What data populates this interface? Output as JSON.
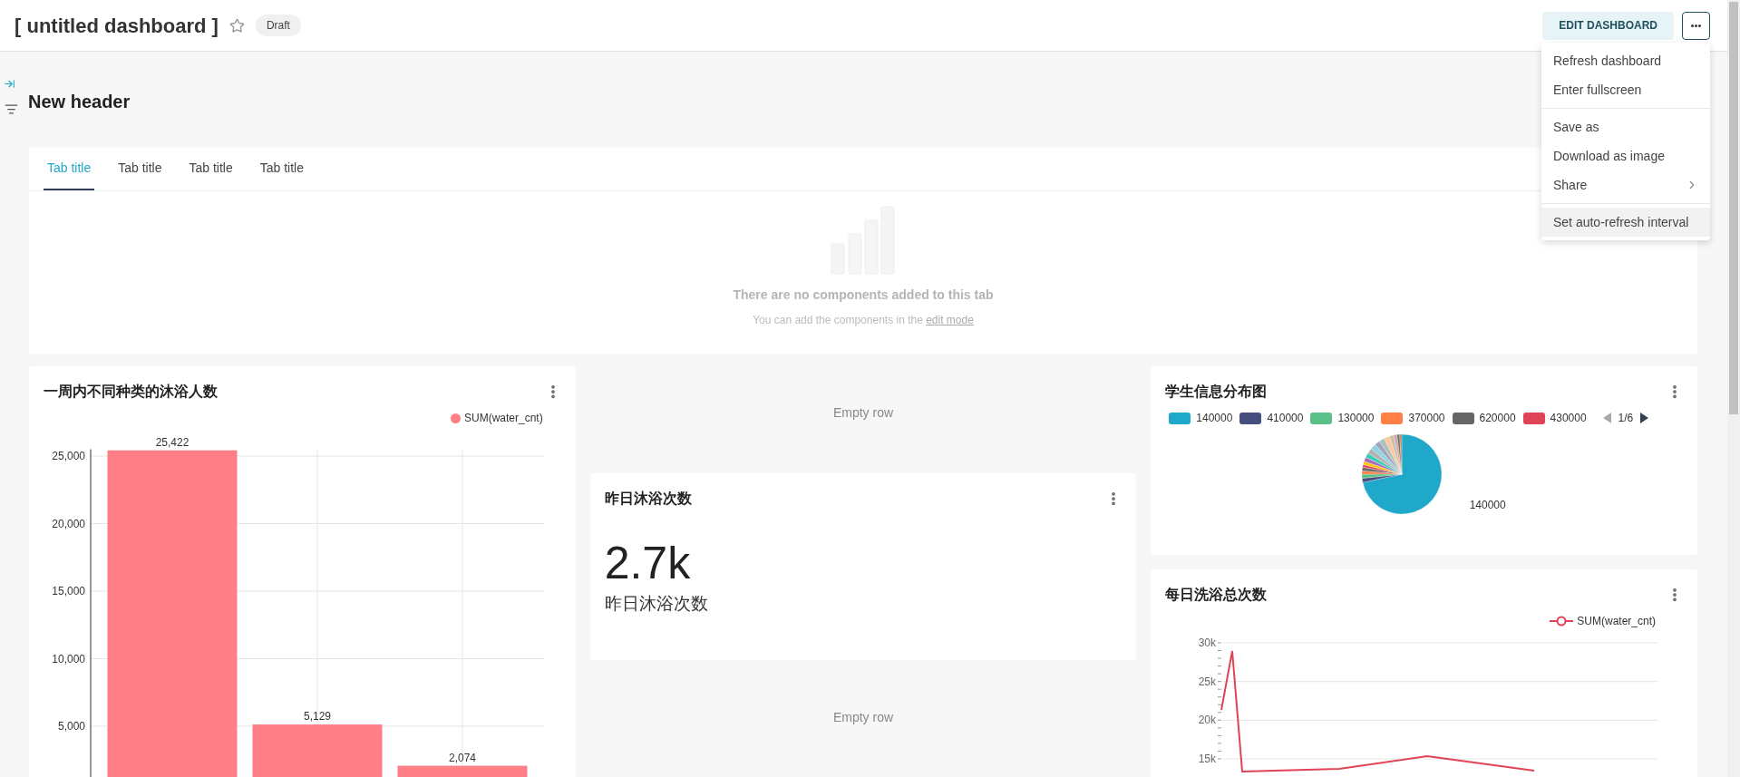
{
  "header": {
    "title": "[ untitled dashboard ]",
    "starred": false,
    "badge": "Draft",
    "edit_button": "EDIT DASHBOARD"
  },
  "menu": {
    "groups": [
      [
        {
          "label": "Refresh dashboard",
          "has_submenu": false,
          "highlighted": false
        },
        {
          "label": "Enter fullscreen",
          "has_submenu": false,
          "highlighted": false
        }
      ],
      [
        {
          "label": "Save as",
          "has_submenu": false,
          "highlighted": false
        },
        {
          "label": "Download as image",
          "has_submenu": false,
          "highlighted": false
        },
        {
          "label": "Share",
          "has_submenu": true,
          "highlighted": false
        }
      ],
      [
        {
          "label": "Set auto-refresh interval",
          "has_submenu": false,
          "highlighted": true
        }
      ]
    ]
  },
  "section_header": "New header",
  "tabs": [
    {
      "label": "Tab title",
      "selected": true
    },
    {
      "label": "Tab title",
      "selected": false
    },
    {
      "label": "Tab title",
      "selected": false
    },
    {
      "label": "Tab title",
      "selected": false
    }
  ],
  "empty_tab": {
    "title": "There are no components added to this tab",
    "text": "You can add the components in the",
    "link": "edit mode"
  },
  "bar_card": {
    "title": "一周内不同种类的沐浴人数",
    "chart_data": {
      "type": "bar",
      "series": [
        {
          "name": "SUM(water_cnt)",
          "color": "#ff7f86",
          "values": [
            25422,
            5129,
            2074
          ]
        }
      ],
      "ylim": [
        0,
        25500
      ],
      "yticks": [
        {
          "value": 5000,
          "label": "5,000"
        },
        {
          "value": 10000,
          "label": "10,000"
        },
        {
          "value": 15000,
          "label": "15,000"
        },
        {
          "value": 20000,
          "label": "20,000"
        },
        {
          "value": 25000,
          "label": "25,000"
        }
      ],
      "grid": true,
      "value_labels": [
        "25,422",
        "5,129",
        "2,074"
      ]
    }
  },
  "empty_rows": [
    "Empty row",
    "Empty row"
  ],
  "big_number_card": {
    "title": "昨日沐浴次数",
    "value": "2.7k",
    "subheader": "昨日沐浴次数"
  },
  "pie_card": {
    "title": "学生信息分布图",
    "legend": [
      {
        "label": "140000",
        "color": "#1fa8c9"
      },
      {
        "label": "410000",
        "color": "#454e7c"
      },
      {
        "label": "130000",
        "color": "#5ac189"
      },
      {
        "label": "370000",
        "color": "#ff7f44"
      },
      {
        "label": "620000",
        "color": "#666666"
      },
      {
        "label": "430000",
        "color": "#e04355"
      }
    ],
    "page": "1/6",
    "slice_label": "140000"
  },
  "line_card": {
    "title": "每日洗浴总次数",
    "legend": {
      "label": "SUM(water_cnt)",
      "color": "#e04355"
    },
    "y_tick_labels": [
      "30k",
      "25k",
      "20k",
      "15k"
    ]
  }
}
